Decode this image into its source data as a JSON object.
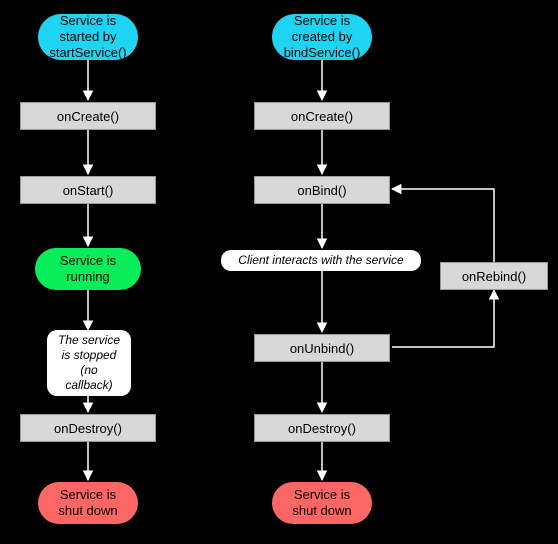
{
  "chart_data": {
    "type": "flowchart",
    "left_flow": {
      "start": "Service is started by startService()",
      "steps": [
        "onCreate()",
        "onStart()"
      ],
      "state": "Service is running",
      "note": "The service is stopped (no callback)",
      "after": [
        "onDestroy()"
      ],
      "end": "Service is shut down"
    },
    "right_flow": {
      "start": "Service is created by bindService()",
      "steps": [
        "onCreate()",
        "onBind()"
      ],
      "note": "Client interacts with the service",
      "loop_step": "onRebind()",
      "after": [
        "onUnbind()",
        "onDestroy()"
      ],
      "end": "Service is shut down"
    }
  },
  "left": {
    "start_l1": "Service is",
    "start_l2": "started by",
    "start_l3": "startService()",
    "onCreate": "onCreate()",
    "onStart": "onStart()",
    "running_l1": "Service is",
    "running_l2": "running",
    "note_l1": "The service",
    "note_l2": "is stopped",
    "note_l3": "(no callback)",
    "onDestroy": "onDestroy()",
    "end_l1": "Service is",
    "end_l2": "shut down"
  },
  "right": {
    "start_l1": "Service is",
    "start_l2": "created by",
    "start_l3": "bindService()",
    "onCreate": "onCreate()",
    "onBind": "onBind()",
    "interact": "Client interacts with the service",
    "onRebind": "onRebind()",
    "onUnbind": "onUnbind()",
    "onDestroy": "onDestroy()",
    "end_l1": "Service is",
    "end_l2": "shut down"
  }
}
